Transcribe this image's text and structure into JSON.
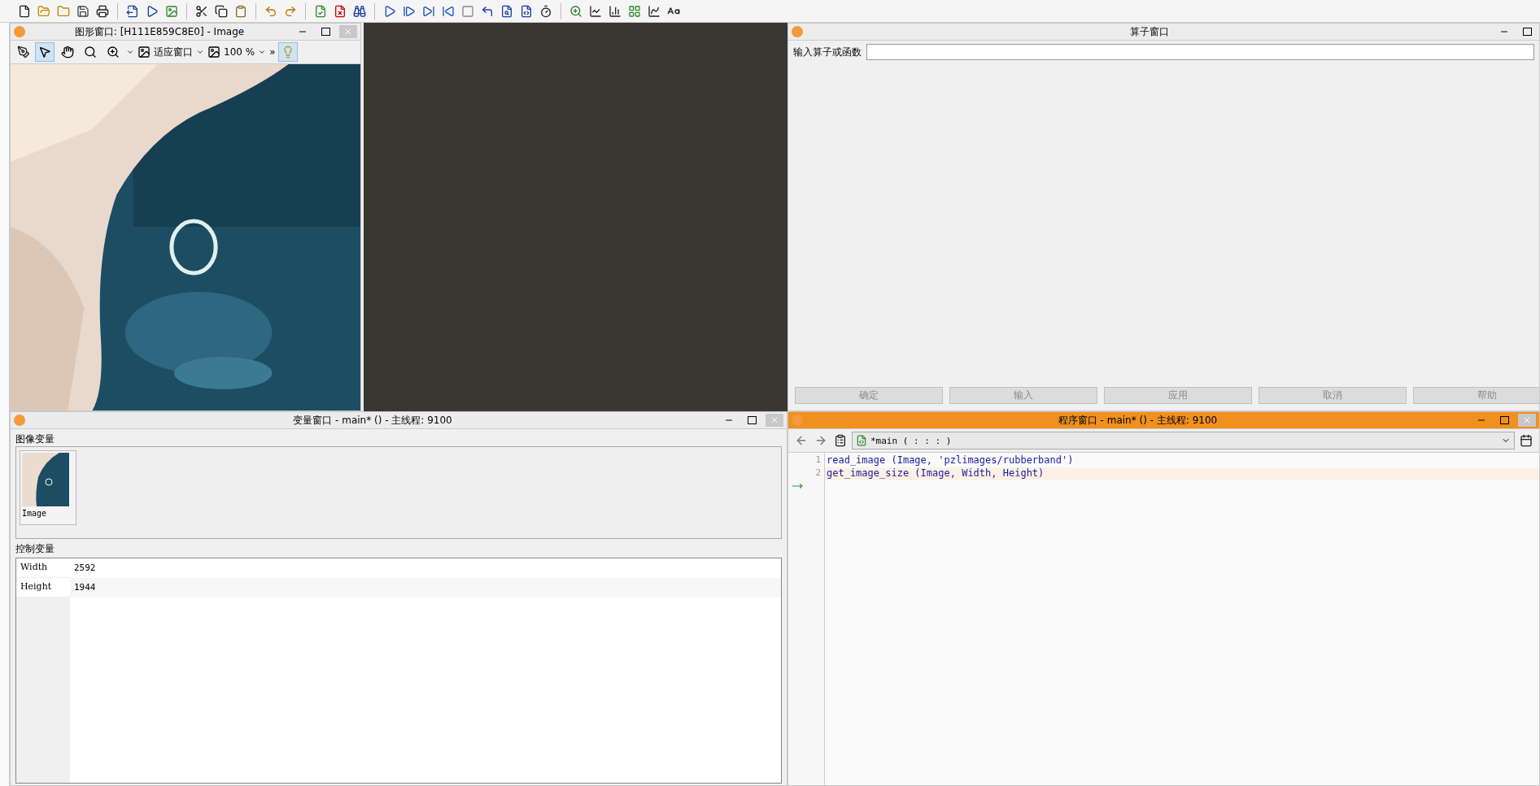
{
  "graphics_window": {
    "title": "图形窗口: [H111E859C8E0] - Image",
    "active": false,
    "tools": [
      {
        "kind": "pointer",
        "selected": true
      },
      {
        "kind": "hand",
        "selected": false
      },
      {
        "kind": "magnifier",
        "selected": false
      },
      {
        "kind": "zoom",
        "selected": false
      }
    ],
    "zoom_mode": "适应窗口",
    "zoom_percent": "100 %",
    "overflow": "»"
  },
  "operator_window": {
    "title": "算子窗口",
    "active": false,
    "input_label": "输入算子或函数",
    "buttons": [
      {
        "label": "确定",
        "disabled": true
      },
      {
        "label": "输入",
        "disabled": true
      },
      {
        "label": "应用",
        "disabled": true
      },
      {
        "label": "取消",
        "disabled": true
      },
      {
        "label": "帮助",
        "disabled": true
      }
    ]
  },
  "variable_window": {
    "title": "变量窗口 - main* () - 主线程: 9100",
    "active": false,
    "iconic_label": "图像变量",
    "iconic_vars": [
      {
        "name": "Image"
      }
    ],
    "control_label": "控制变量",
    "control_vars": [
      {
        "name": "Width",
        "value": "2592"
      },
      {
        "name": "Height",
        "value": "1944"
      }
    ]
  },
  "program_window": {
    "title": "程序窗口 - main* () - 主线程: 9100",
    "active": true,
    "procedure": "*main ( : : : )",
    "lines": [
      {
        "number": "1",
        "code": "read_image (Image, 'pzlimages/rubberband')",
        "current": false
      },
      {
        "number": "2",
        "code": "get_image_size (Image, Width, Height)",
        "current": true
      }
    ]
  }
}
